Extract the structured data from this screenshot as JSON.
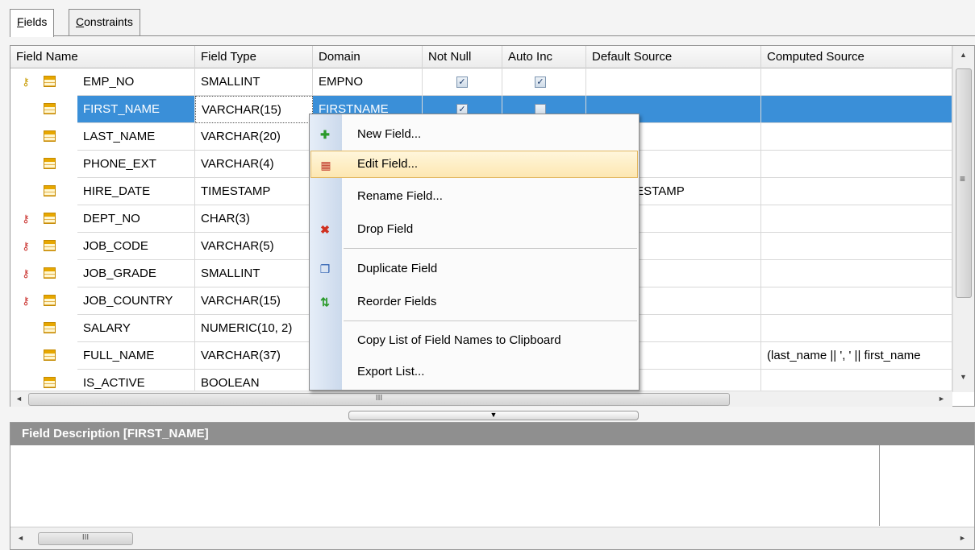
{
  "tabs": [
    {
      "label": "Fields",
      "accel": "F",
      "rest": "ields"
    },
    {
      "label": "Constraints",
      "accel": "C",
      "rest": "onstraints"
    }
  ],
  "columns": [
    "Field Name",
    "Field Type",
    "Domain",
    "Not Null",
    "Auto Inc",
    "Default Source",
    "Computed Source"
  ],
  "rows": [
    {
      "name": "EMP_NO",
      "type": "SMALLINT",
      "domain": "EMPNO",
      "not_null": true,
      "auto_inc": true,
      "default": "",
      "computed": "",
      "key": "primary"
    },
    {
      "name": "FIRST_NAME",
      "type": "VARCHAR(15)",
      "domain": "FIRSTNAME",
      "not_null": true,
      "auto_inc": false,
      "default": "",
      "computed": "",
      "key": "",
      "selected": true
    },
    {
      "name": "LAST_NAME",
      "type": "VARCHAR(20)",
      "domain": "",
      "default": "",
      "computed": "",
      "key": ""
    },
    {
      "name": "PHONE_EXT",
      "type": "VARCHAR(4)",
      "domain": "",
      "default": "",
      "computed": "",
      "key": ""
    },
    {
      "name": "HIRE_DATE",
      "type": "TIMESTAMP",
      "domain": "",
      "default": "NT_TIMESTAMP",
      "computed": "",
      "key": ""
    },
    {
      "name": "DEPT_NO",
      "type": "CHAR(3)",
      "domain": "",
      "default": "",
      "computed": "",
      "key": "foreign"
    },
    {
      "name": "JOB_CODE",
      "type": "VARCHAR(5)",
      "domain": "",
      "default": "",
      "computed": "",
      "key": "foreign"
    },
    {
      "name": "JOB_GRADE",
      "type": "SMALLINT",
      "domain": "",
      "default": "",
      "computed": "",
      "key": "foreign"
    },
    {
      "name": "JOB_COUNTRY",
      "type": "VARCHAR(15)",
      "domain": "",
      "default": "",
      "computed": "",
      "key": "foreign"
    },
    {
      "name": "SALARY",
      "type": "NUMERIC(10, 2)",
      "domain": "",
      "default": "",
      "computed": "",
      "key": ""
    },
    {
      "name": "FULL_NAME",
      "type": "VARCHAR(37)",
      "domain": "",
      "default": "",
      "computed": "(last_name || ', ' || first_name",
      "key": ""
    },
    {
      "name": "IS_ACTIVE",
      "type": "BOOLEAN",
      "domain": "",
      "default": "",
      "computed": "",
      "key": ""
    }
  ],
  "scrollbar": {
    "grip": "III"
  },
  "description": {
    "title": "Field Description [FIRST_NAME]"
  },
  "context_menu": {
    "items": [
      {
        "label": "New Field...",
        "icon": "new-field-icon"
      },
      {
        "label": "Edit Field...",
        "icon": "edit-field-icon",
        "highlighted": true
      },
      {
        "label": "Rename Field...",
        "icon": ""
      },
      {
        "label": "Drop Field",
        "icon": "drop-field-icon"
      },
      {
        "label": "Duplicate Field",
        "icon": "duplicate-field-icon"
      },
      {
        "label": "Reorder Fields",
        "icon": "reorder-fields-icon"
      },
      {
        "label": "Copy List of Field Names to Clipboard",
        "icon": ""
      },
      {
        "label": "Export List...",
        "icon": ""
      }
    ]
  },
  "colors": {
    "selection": "#3a8fd8",
    "menu_highlight": "#fde7b1",
    "desc_header": "#8f8f8f"
  }
}
